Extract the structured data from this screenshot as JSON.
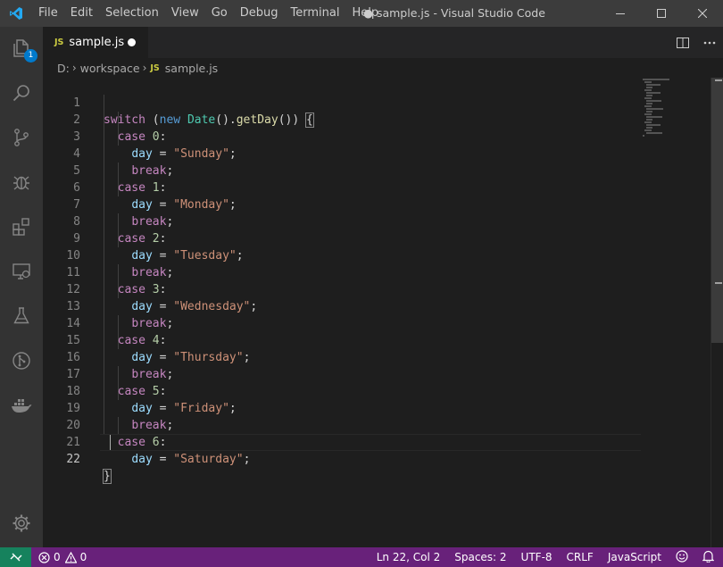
{
  "titlebar": {
    "menus": [
      "File",
      "Edit",
      "Selection",
      "View",
      "Go",
      "Debug",
      "Terminal",
      "Help"
    ],
    "title": "● sample.js - Visual Studio Code"
  },
  "activitybar": {
    "items": [
      "files-icon",
      "search-icon",
      "source-control-icon",
      "debug-icon",
      "extensions-icon",
      "remote-explorer-icon",
      "testing-icon",
      "git-graph-icon",
      "docker-icon"
    ],
    "explorer_badge": "1",
    "settings": "gear-icon"
  },
  "tab": {
    "icon_label": "JS",
    "name": "sample.js",
    "dirty": true
  },
  "breadcrumb": {
    "drive": "D:",
    "folder": "workspace",
    "file_icon": "JS",
    "file": "sample.js"
  },
  "editor": {
    "line_numbers": [
      "1",
      "2",
      "3",
      "4",
      "5",
      "6",
      "7",
      "8",
      "9",
      "10",
      "11",
      "12",
      "13",
      "14",
      "15",
      "16",
      "17",
      "18",
      "19",
      "20",
      "21",
      "22"
    ],
    "days": [
      "\"Sunday\"",
      "\"Monday\"",
      "\"Tuesday\"",
      "\"Wednesday\"",
      "\"Thursday\"",
      "\"Friday\"",
      "\"Saturday\""
    ],
    "cases": [
      "0",
      "1",
      "2",
      "3",
      "4",
      "5",
      "6"
    ]
  },
  "statusbar": {
    "errors": "0",
    "warnings": "0",
    "position": "Ln 22, Col 2",
    "spaces": "Spaces: 2",
    "encoding": "UTF-8",
    "eol": "CRLF",
    "language": "JavaScript"
  },
  "colors": {
    "statusbar": "#68217a",
    "remote": "#16825d",
    "accent": "#007acc"
  }
}
